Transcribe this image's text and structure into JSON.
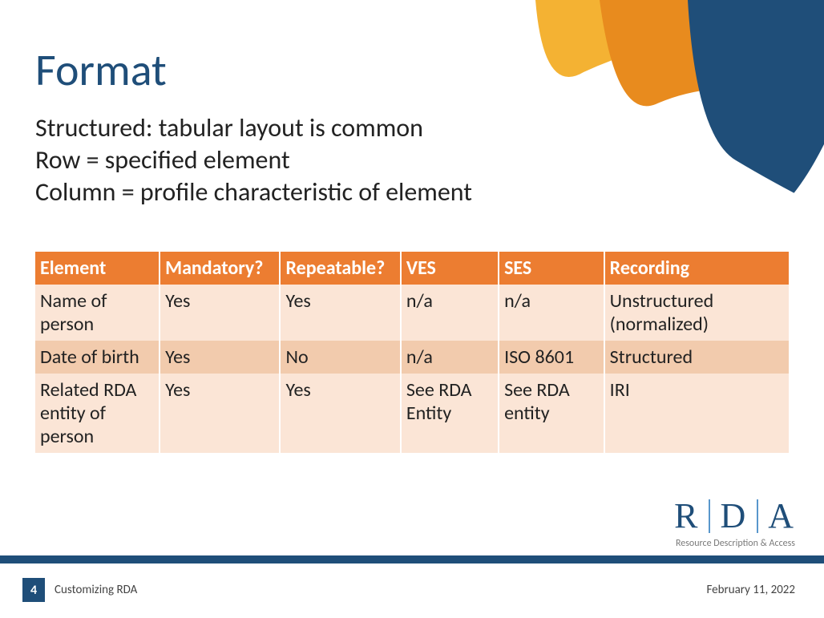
{
  "title": "Format",
  "body_lines": [
    "Structured: tabular layout is common",
    "Row = specified element",
    "Column = profile characteristic of element"
  ],
  "table": {
    "headers": [
      "Element",
      "Mandatory?",
      "Repeatable?",
      "VES",
      "SES",
      "Recording"
    ],
    "rows": [
      {
        "cells": [
          "Name of person",
          "Yes",
          "Yes",
          "n/a",
          "n/a",
          "Unstructured (normalized)"
        ]
      },
      {
        "cells": [
          "Date of birth",
          "Yes",
          "No",
          "n/a",
          "ISO 8601",
          "Structured"
        ]
      },
      {
        "cells": [
          "Related RDA entity of person",
          "Yes",
          "Yes",
          "See RDA Entity",
          "See RDA entity",
          "IRI"
        ]
      }
    ]
  },
  "logo": {
    "letters": [
      "R",
      "D",
      "A"
    ],
    "tagline": "Resource Description & Access"
  },
  "footer": {
    "page": "4",
    "left": "Customizing RDA",
    "right": "February 11, 2022"
  },
  "colors": {
    "accent": "#1f4e79",
    "table_header": "#ec7d31",
    "row_odd": "#fbe5d6",
    "row_even": "#f2cbad"
  }
}
